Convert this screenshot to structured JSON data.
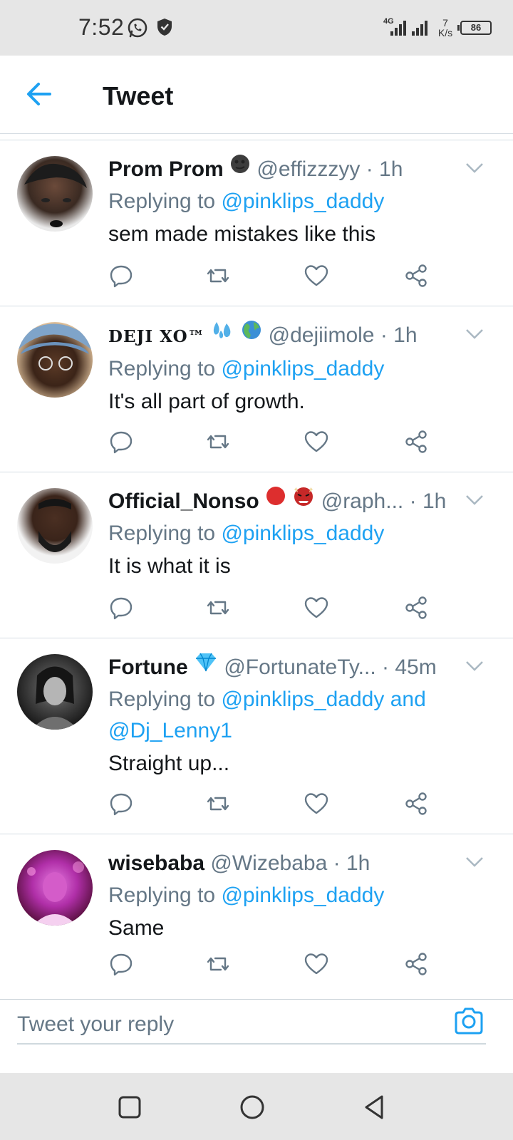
{
  "status_bar": {
    "time": "7:52",
    "network": "4G",
    "speed_value": "7",
    "speed_unit": "K/s",
    "battery": "86"
  },
  "header": {
    "title": "Tweet"
  },
  "tweets": [
    {
      "name": "Prom Prom",
      "name_emojis": [
        "🌚"
      ],
      "handle": "@effizzzyy",
      "time": "1h",
      "replying_prefix": "Replying to ",
      "replying_to": "@pinklips_daddy",
      "replying_extra": "",
      "text": "sem made mistakes like this"
    },
    {
      "name": "DEJI XO™",
      "name_emojis": [
        "💦",
        "🌍"
      ],
      "handle": "@dejiimole",
      "time": "1h",
      "replying_prefix": "Replying to ",
      "replying_to": "@pinklips_daddy",
      "replying_extra": "",
      "text": "It's all part of growth."
    },
    {
      "name": "Official_Nonso",
      "name_emojis": [
        "🔴",
        "👹"
      ],
      "handle": "@raph...",
      "time": "1h",
      "replying_prefix": "Replying to ",
      "replying_to": "@pinklips_daddy",
      "replying_extra": "",
      "text": "It is what it is"
    },
    {
      "name": "Fortune",
      "name_emojis": [
        "💎"
      ],
      "handle": "@FortunateTy...",
      "time": "45m",
      "replying_prefix": "Replying to ",
      "replying_to": "@pinklips_daddy and",
      "replying_extra": "@Dj_Lenny1",
      "text": "Straight up..."
    },
    {
      "name": "wisebaba",
      "name_emojis": [],
      "handle": "@Wizebaba",
      "time": "1h",
      "replying_prefix": "Replying to ",
      "replying_to": "@pinklips_daddy",
      "replying_extra": "",
      "text": "Same"
    }
  ],
  "reply_bar": {
    "placeholder": "Tweet your reply"
  },
  "colors": {
    "accent": "#1da1f2",
    "secondary_text": "#657786",
    "primary_text": "#14171a",
    "divider": "#d5dde3"
  }
}
